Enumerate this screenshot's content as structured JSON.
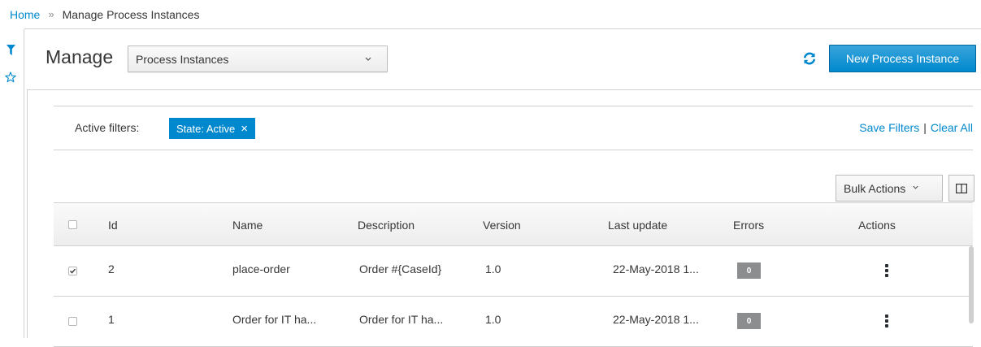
{
  "breadcrumb": {
    "home": "Home",
    "separator": "»",
    "current": "Manage Process Instances"
  },
  "rail": {
    "filter_icon": "filter-icon",
    "favorites_icon": "star-outline-icon"
  },
  "header": {
    "title": "Manage",
    "select_value": "Process Instances",
    "refresh_icon": "refresh-icon",
    "new_button": "New Process Instance"
  },
  "filters": {
    "label": "Active filters:",
    "chips": [
      {
        "label": "State: Active",
        "close": "×"
      }
    ],
    "save": "Save Filters",
    "divider": "|",
    "clear": "Clear All"
  },
  "toolbar": {
    "bulk_actions": "Bulk Actions",
    "bulk_chevron": "⌄",
    "columns_icon": "columns-icon"
  },
  "table": {
    "columns": [
      "Id",
      "Name",
      "Description",
      "Version",
      "Last update",
      "Errors",
      "Actions"
    ],
    "rows": [
      {
        "checked": true,
        "id": "2",
        "name": "place-order",
        "description": "Order #{CaseId}",
        "version": "1.0",
        "last_update": "22-May-2018 1...",
        "errors": "0"
      },
      {
        "checked": false,
        "id": "1",
        "name": "Order for IT ha...",
        "description": "Order for IT ha...",
        "version": "1.0",
        "last_update": "22-May-2018 1...",
        "errors": "0"
      }
    ]
  },
  "colors": {
    "accent": "#0088ce",
    "primary_button": "#39a5dc",
    "badge": "#8b8d8f",
    "border": "#d1d1d1"
  }
}
